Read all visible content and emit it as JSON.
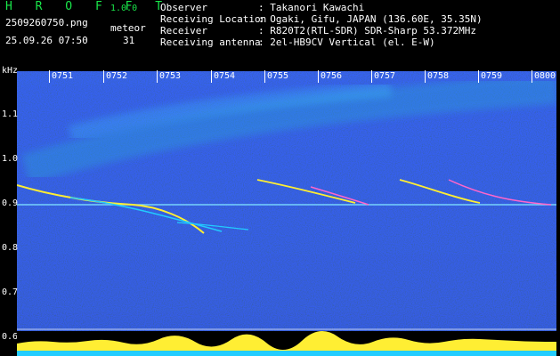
{
  "header": {
    "app_title": "H R O F F T",
    "version": "1.0.0",
    "filename": "2509260750.png",
    "datetime": "25.09.26 07:50",
    "meteor_label": "meteor",
    "meteor_count": "31",
    "info_rows": [
      {
        "label": "Observer",
        "value": ": Takanori Kawachi"
      },
      {
        "label": "Receiving Location",
        "value": ": Ogaki, Gifu, JAPAN (136.60E, 35.35N)"
      },
      {
        "label": "Receiver",
        "value": ": R820T2(RTL-SDR) SDR-Sharp 53.372MHz"
      },
      {
        "label": "Receiving antenna",
        "value": ": 2el-HB9CV Vertical (el. E-W)"
      }
    ]
  },
  "axes": {
    "y_unit": "kHz",
    "y_ticks": [
      "1.1",
      "1.0",
      "0.9",
      "0.8",
      "0.7",
      "0.6"
    ],
    "x_ticks": [
      "0751",
      "0752",
      "0753",
      "0754",
      "0755",
      "0756",
      "0757",
      "0758",
      "0759",
      "0800"
    ]
  },
  "colors": {
    "background": "#000000",
    "title_green": "#19e64a",
    "spectrum_low": "#0010a0",
    "spectrum_high": "#30c8ff",
    "signal_yellow": "#ffee33",
    "signal_cyan": "#22ccff"
  }
}
